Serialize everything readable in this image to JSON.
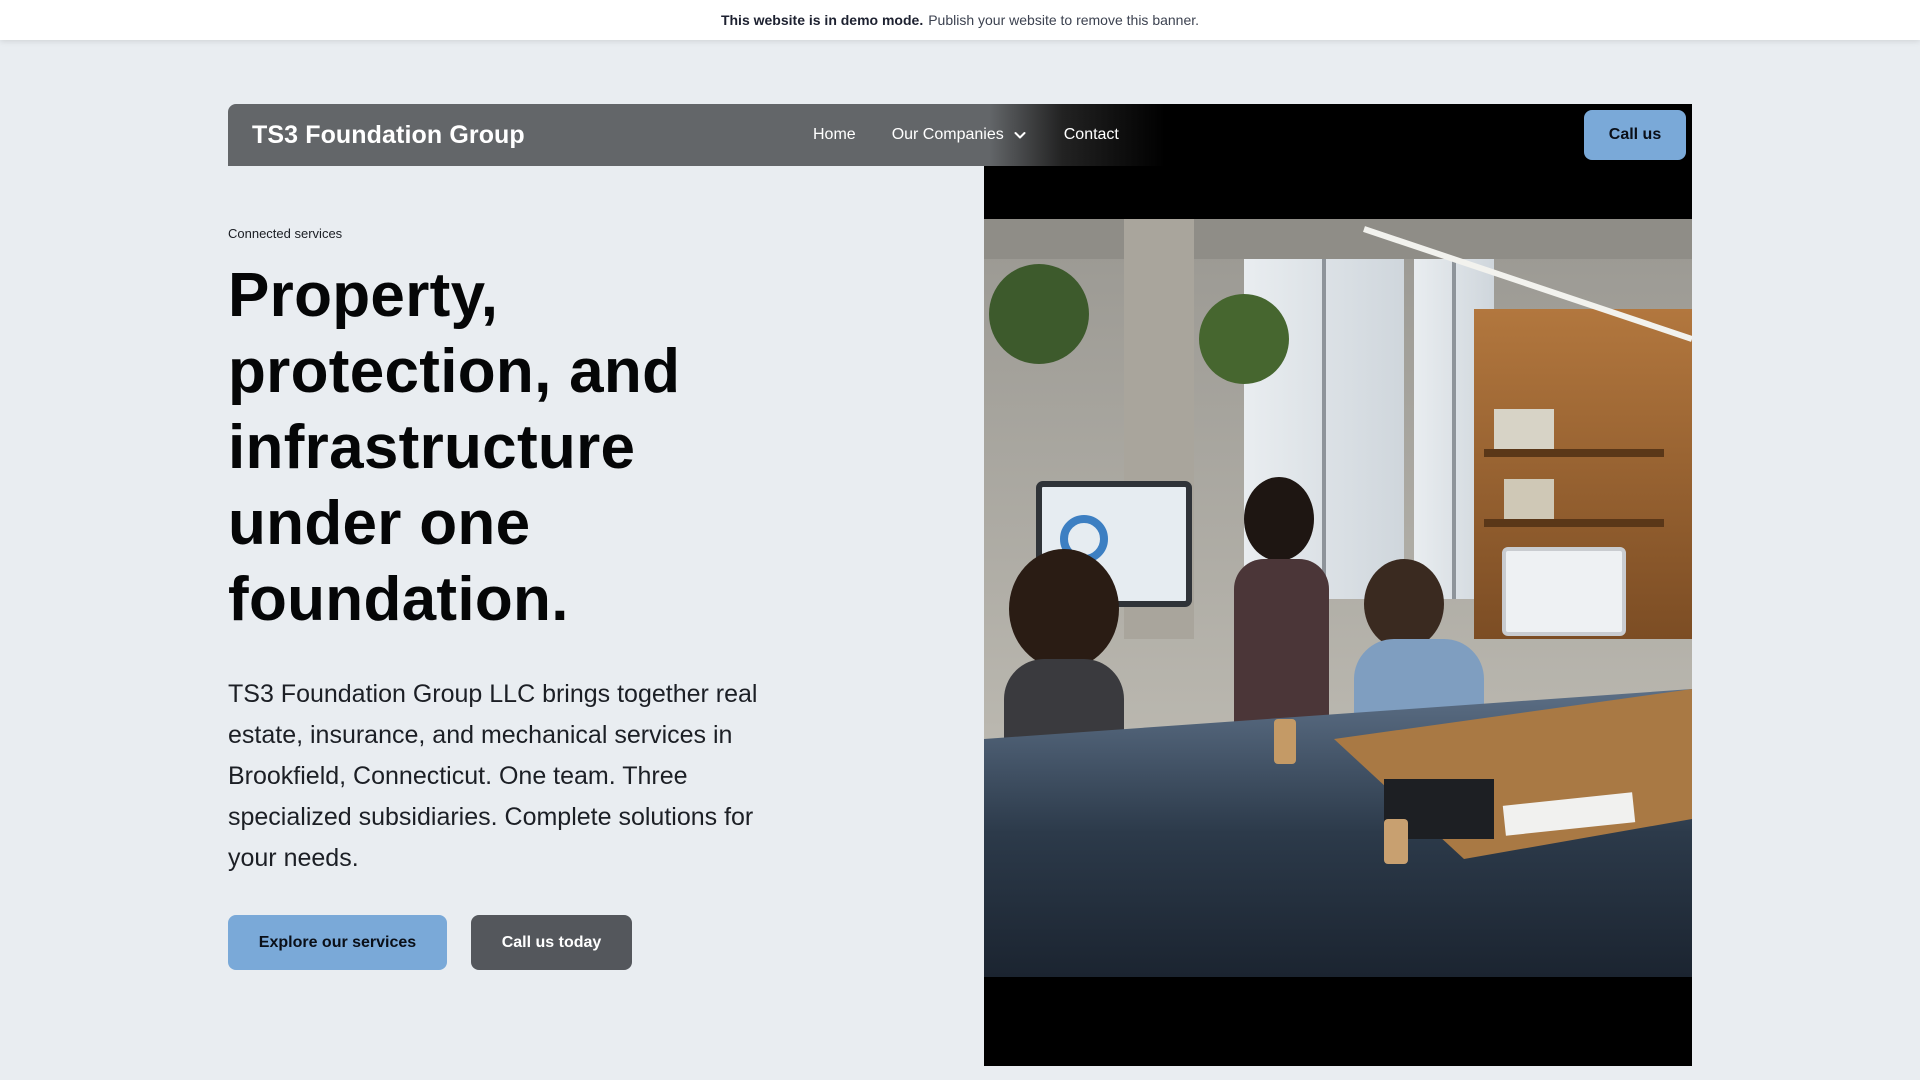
{
  "banner": {
    "strong_text": "This website is in demo mode.",
    "text": "Publish your website to remove this banner."
  },
  "nav": {
    "brand": "TS3 Foundation Group",
    "links": [
      {
        "label": "Home"
      },
      {
        "label": "Our Companies",
        "icon": "chevron-down-icon"
      },
      {
        "label": "Contact"
      }
    ],
    "cta": "Call us"
  },
  "hero": {
    "eyebrow": "Connected services",
    "headline": "Property, protection, and infrastructure under one foundation.",
    "lead": "TS3 Foundation Group LLC brings together real estate, insurance, and mechanical services in Brookfield, Connecticut. One team. Three specialized subsidiaries. Complete solutions for your needs.",
    "primary_button": "Explore our services",
    "secondary_button": "Call us today"
  },
  "colors": {
    "page_background": "#e9edf1",
    "navbar": "#636669",
    "accent_button": "#7aa9d8",
    "secondary_button": "#54575c",
    "image_frame": "#000000"
  }
}
